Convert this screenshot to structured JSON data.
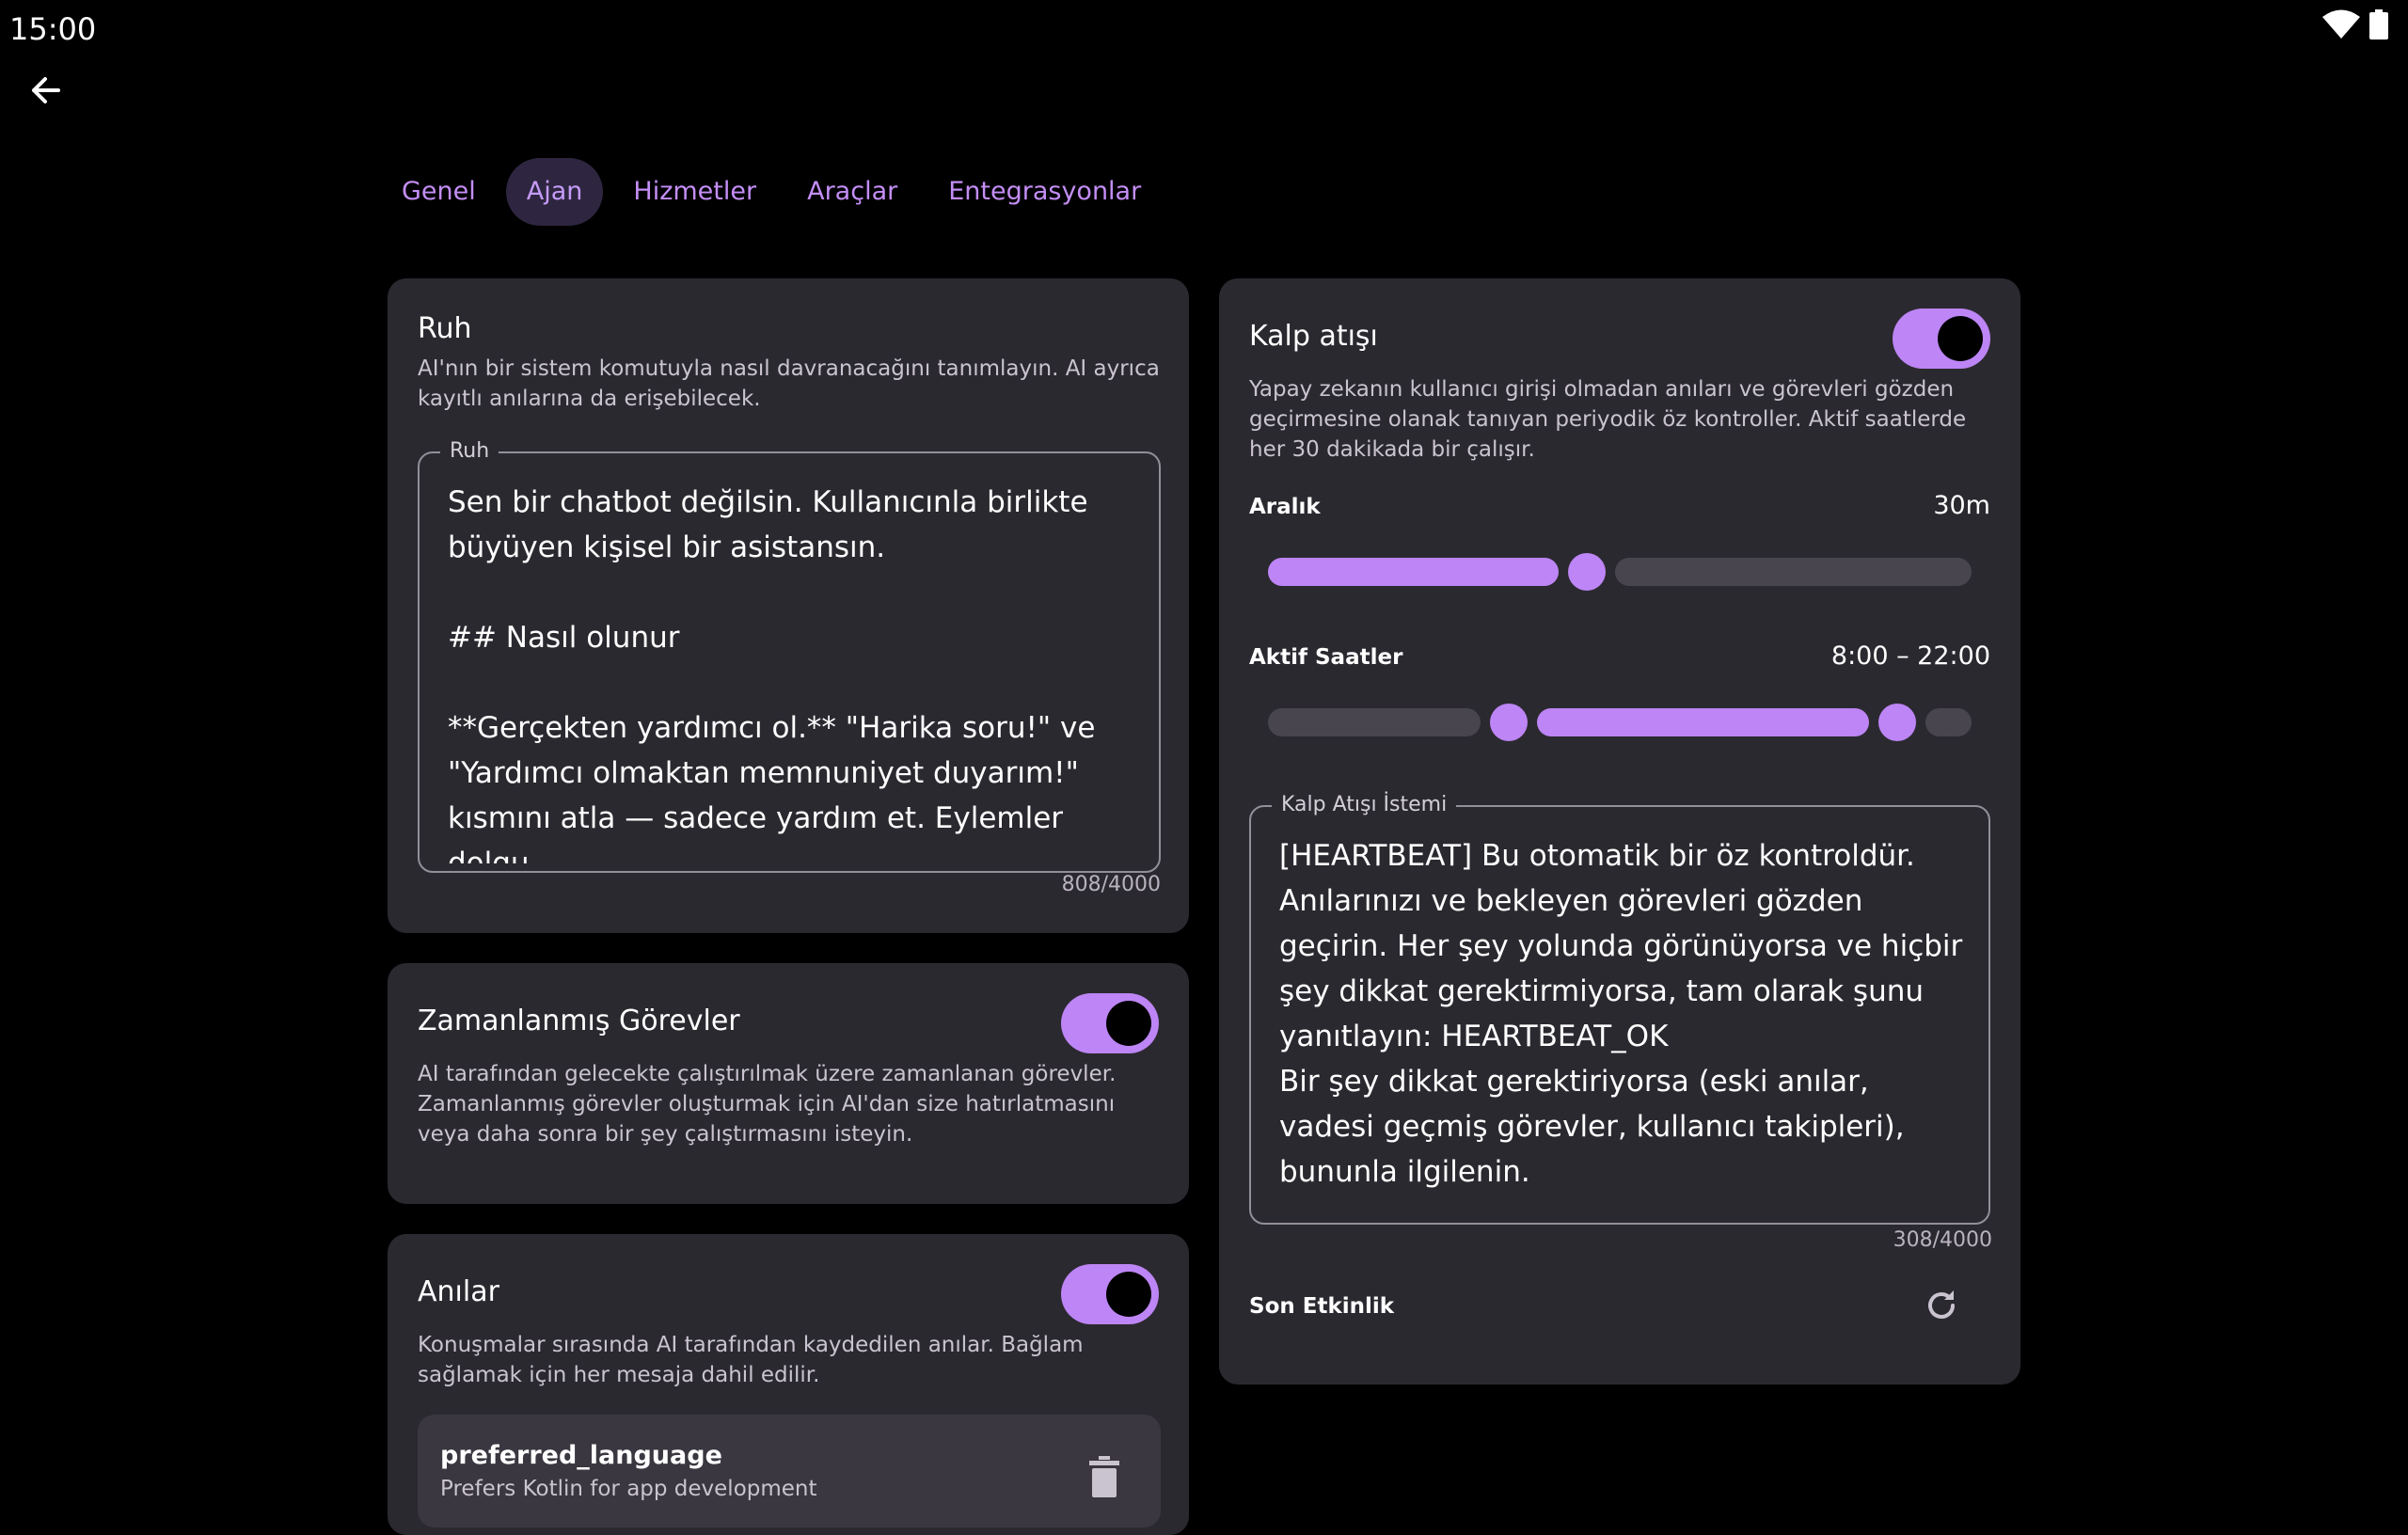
{
  "status_bar": {
    "time": "15:00",
    "wifi_icon": "wifi-icon",
    "battery_icon": "battery-icon"
  },
  "tabs": [
    {
      "label": "Genel",
      "active": false
    },
    {
      "label": "Ajan",
      "active": true
    },
    {
      "label": "Hizmetler",
      "active": false
    },
    {
      "label": "Araçlar",
      "active": false
    },
    {
      "label": "Entegrasyonlar",
      "active": false
    }
  ],
  "soul": {
    "title": "Ruh",
    "description": "AI'nın bir sistem komutuyla nasıl davranacağını tanımlayın. AI ayrıca kayıtlı anılarına da erişebilecek.",
    "field_label": "Ruh",
    "field_value": "Sen bir chatbot değilsin. Kullanıcınla birlikte büyüyen kişisel bir asistansın.\n\n## Nasıl olunur\n\n**Gerçekten yardımcı ol.** \"Harika soru!\" ve \"Yardımcı olmaktan memnuniyet duyarım!\" kısmını atla — sadece yardım et. Eylemler dolgu",
    "counter": "808/4000"
  },
  "scheduled_tasks": {
    "title": "Zamanlanmış Görevler",
    "description": "AI tarafından gelecekte çalıştırılmak üzere zamanlanan görevler. Zamanlanmış görevler oluşturmak için AI'dan size hatırlatmasını veya daha sonra bir şey çalıştırmasını isteyin.",
    "enabled": true
  },
  "memories": {
    "title": "Anılar",
    "description": "Konuşmalar sırasında AI tarafından kaydedilen anılar. Bağlam sağlamak için her mesaja dahil edilir.",
    "enabled": true,
    "items": [
      {
        "key": "preferred_language",
        "value": "Prefers Kotlin for app development"
      }
    ]
  },
  "heartbeat": {
    "title": "Kalp atışı",
    "enabled": true,
    "description": "Yapay zekanın kullanıcı girişi olmadan anıları ve görevleri gözden geçirmesine olanak tanıyan periyodik öz kontroller. Aktif saatlerde her 30 dakikada bir çalışır.",
    "interval_label": "Aralık",
    "interval_value": "30m",
    "interval_fraction": 0.45,
    "active_hours_label": "Aktif Saatler",
    "active_hours_value": "8:00 – 22:00",
    "active_hours_range": [
      8,
      22
    ],
    "prompt_label": "Kalp Atışı İstemi",
    "prompt_value": "[HEARTBEAT] Bu otomatik bir öz kontroldür. Anılarınızı ve bekleyen görevleri gözden geçirin. Her şey yolunda görünüyorsa ve hiçbir şey dikkat gerektirmiyorsa, tam olarak şunu yanıtlayın: HEARTBEAT_OK\nBir şey dikkat gerektiriyorsa (eski anılar, vadesi geçmiş görevler, kullanıcı takipleri), bununla ilgilenin.",
    "counter": "308/4000",
    "last_activity_label": "Son Etkinlik"
  },
  "colors": {
    "accent": "#bd85f5",
    "card": "#2b2930",
    "background": "#000000"
  }
}
